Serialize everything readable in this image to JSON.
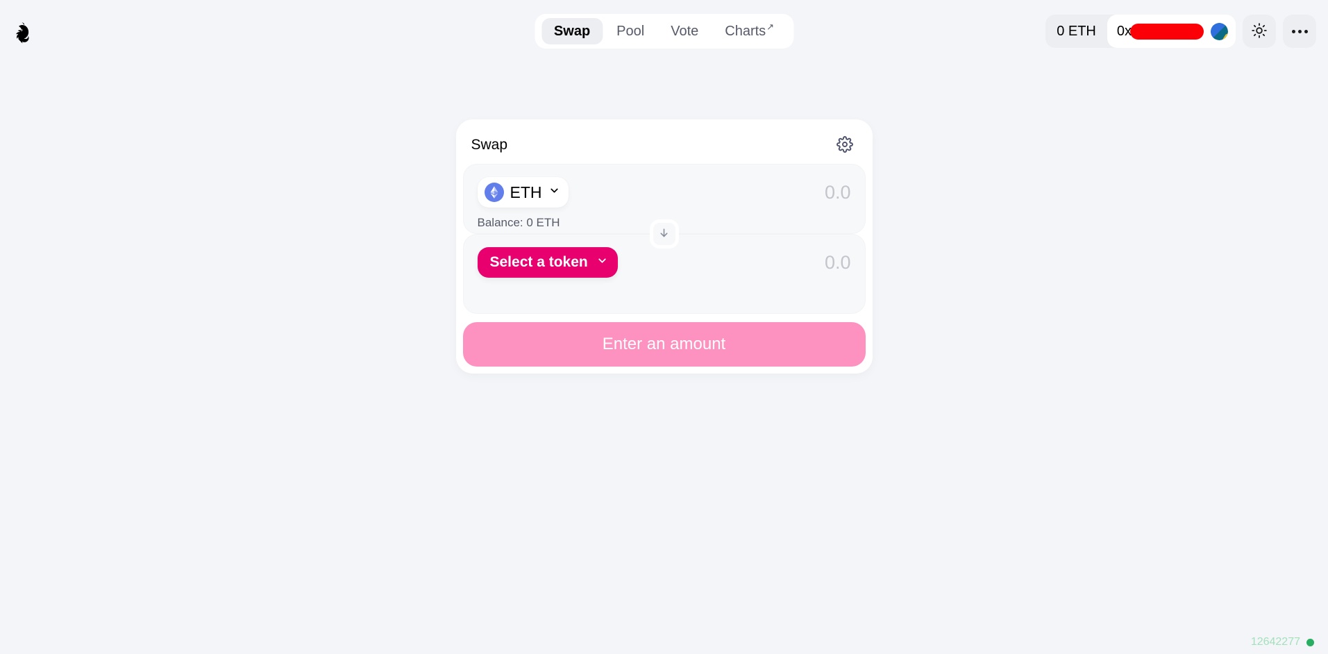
{
  "brand": {
    "logo_icon": "uniswap-unicorn-logo"
  },
  "nav": {
    "items": [
      {
        "label": "Swap",
        "active": true,
        "external": false
      },
      {
        "label": "Pool",
        "active": false,
        "external": false
      },
      {
        "label": "Vote",
        "active": false,
        "external": false
      },
      {
        "label": "Charts",
        "active": false,
        "external": true,
        "external_glyph": "↗"
      }
    ]
  },
  "wallet": {
    "balance": "0 ETH",
    "address_prefix": "0x",
    "address_redacted": true,
    "avatar_icon": "wallet-avatar",
    "redaction_color": "#fb0007"
  },
  "header_actions": {
    "theme_toggle_icon": "sun-icon",
    "more_menu_icon": "more-horizontal-icon"
  },
  "swap_card": {
    "title": "Swap",
    "settings_icon": "gear-icon",
    "input_panel": {
      "token_symbol": "ETH",
      "token_logo_icon": "ethereum-icon",
      "chevron_icon": "chevron-down-icon",
      "amount_value": "",
      "amount_placeholder": "0.0",
      "balance_label": "Balance: 0 ETH"
    },
    "switch_icon": "arrow-down-icon",
    "output_panel": {
      "token_symbol": "Select a token",
      "chevron_icon": "chevron-down-icon",
      "amount_value": "",
      "amount_placeholder": "0.0",
      "select_button_color": "#e8006f"
    },
    "action_button": {
      "label": "Enter an amount",
      "disabled": true,
      "color": "#fd91c0"
    }
  },
  "status": {
    "block_number": "12642277",
    "indicator_color": "#27ae60"
  }
}
